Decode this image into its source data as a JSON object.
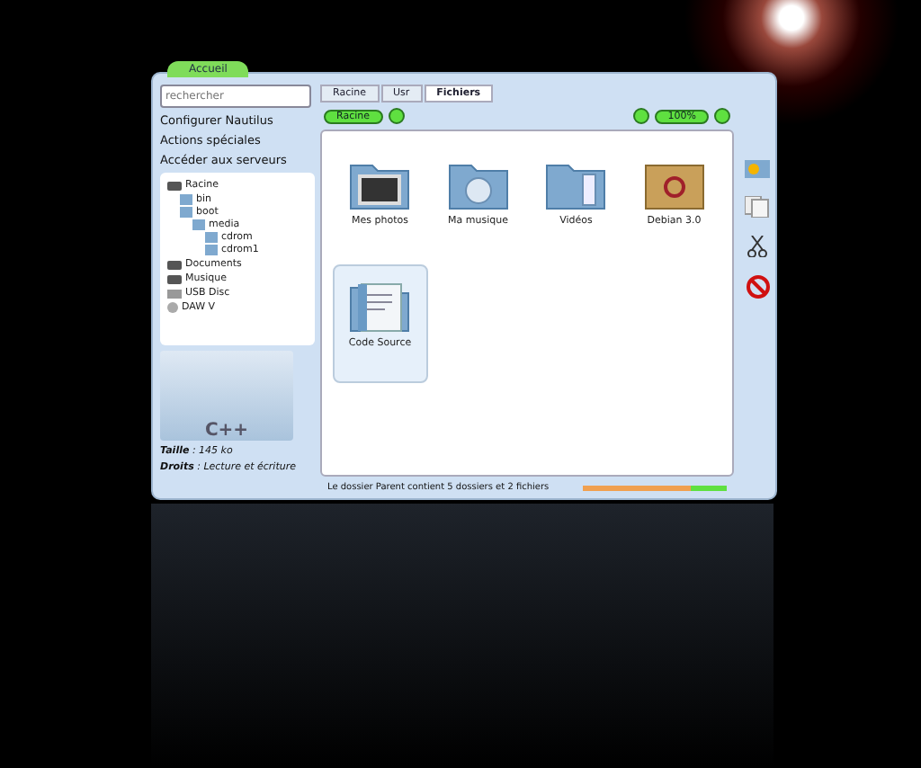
{
  "window": {
    "title": "Accueil"
  },
  "search": {
    "placeholder": "rechercher"
  },
  "sidebar": {
    "actions": [
      "Configurer Nautilus",
      "Actions spéciales",
      "Accéder aux serveurs"
    ],
    "tree": [
      {
        "label": "Racine",
        "kind": "drive",
        "children": [
          {
            "label": "bin",
            "kind": "folder"
          },
          {
            "label": "boot",
            "kind": "folder",
            "children": [
              {
                "label": "media",
                "kind": "folder",
                "children": [
                  {
                    "label": "cdrom",
                    "kind": "folder"
                  },
                  {
                    "label": "cdrom1",
                    "kind": "folder"
                  }
                ]
              }
            ]
          }
        ]
      },
      {
        "label": "Documents",
        "kind": "drive"
      },
      {
        "label": "Musique",
        "kind": "drive"
      },
      {
        "label": "USB Disc",
        "kind": "usb"
      },
      {
        "label": "DAW V",
        "kind": "disc"
      }
    ],
    "preview": {
      "caption": "C++"
    },
    "info": [
      "**Taille** : 145 ko",
      "**Droits** : Lecture et écriture"
    ]
  },
  "tabs": [
    {
      "label": "Racine",
      "selected": false
    },
    {
      "label": "Usr",
      "selected": false
    },
    {
      "label": "Fichiers",
      "selected": true
    }
  ],
  "location": {
    "label": "Racine"
  },
  "zoom": {
    "label": "100%"
  },
  "files": [
    {
      "label": "Mes photos",
      "kind": "pictures",
      "selected": false
    },
    {
      "label": "Ma musique",
      "kind": "music",
      "selected": false
    },
    {
      "label": "Vidéos",
      "kind": "videos",
      "selected": false
    },
    {
      "label": "Debian 3.0",
      "kind": "package",
      "selected": false
    },
    {
      "label": "Code Source",
      "kind": "source",
      "selected": true
    }
  ],
  "status_bar": {
    "text": "Le dossier Parent contient 5 dossiers et 2 fichiers",
    "level": 0.75
  }
}
